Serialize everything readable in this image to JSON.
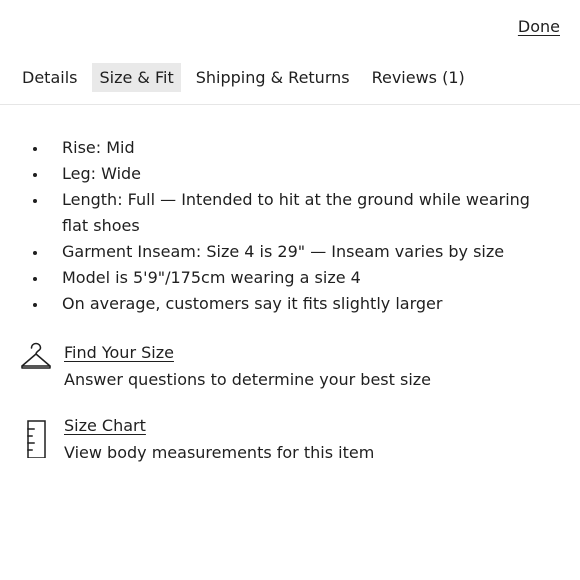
{
  "header": {
    "done_label": "Done"
  },
  "tabs": [
    {
      "label": "Details",
      "active": false
    },
    {
      "label": "Size & Fit",
      "active": true
    },
    {
      "label": "Shipping & Returns",
      "active": false
    },
    {
      "label": "Reviews (1)",
      "active": false
    }
  ],
  "size_fit": {
    "items": [
      "Rise: Mid",
      "Leg: Wide",
      "Length: Full — Intended to hit at the ground while wearing flat shoes",
      "Garment Inseam: Size 4 is 29\" — Inseam varies by size",
      "Model is 5'9\"/175cm wearing a size 4",
      "On average, customers say it fits slightly larger"
    ]
  },
  "tools": {
    "find_size": {
      "icon": "hanger-icon",
      "link": "Find Your Size",
      "description": "Answer questions to determine your best size"
    },
    "size_chart": {
      "icon": "ruler-icon",
      "link": "Size Chart",
      "description": "View body measurements for this item"
    }
  },
  "colors": {
    "text": "#1f1f1f",
    "active_tab_bg": "#e9e9e9",
    "divider": "#e6e6e6"
  }
}
